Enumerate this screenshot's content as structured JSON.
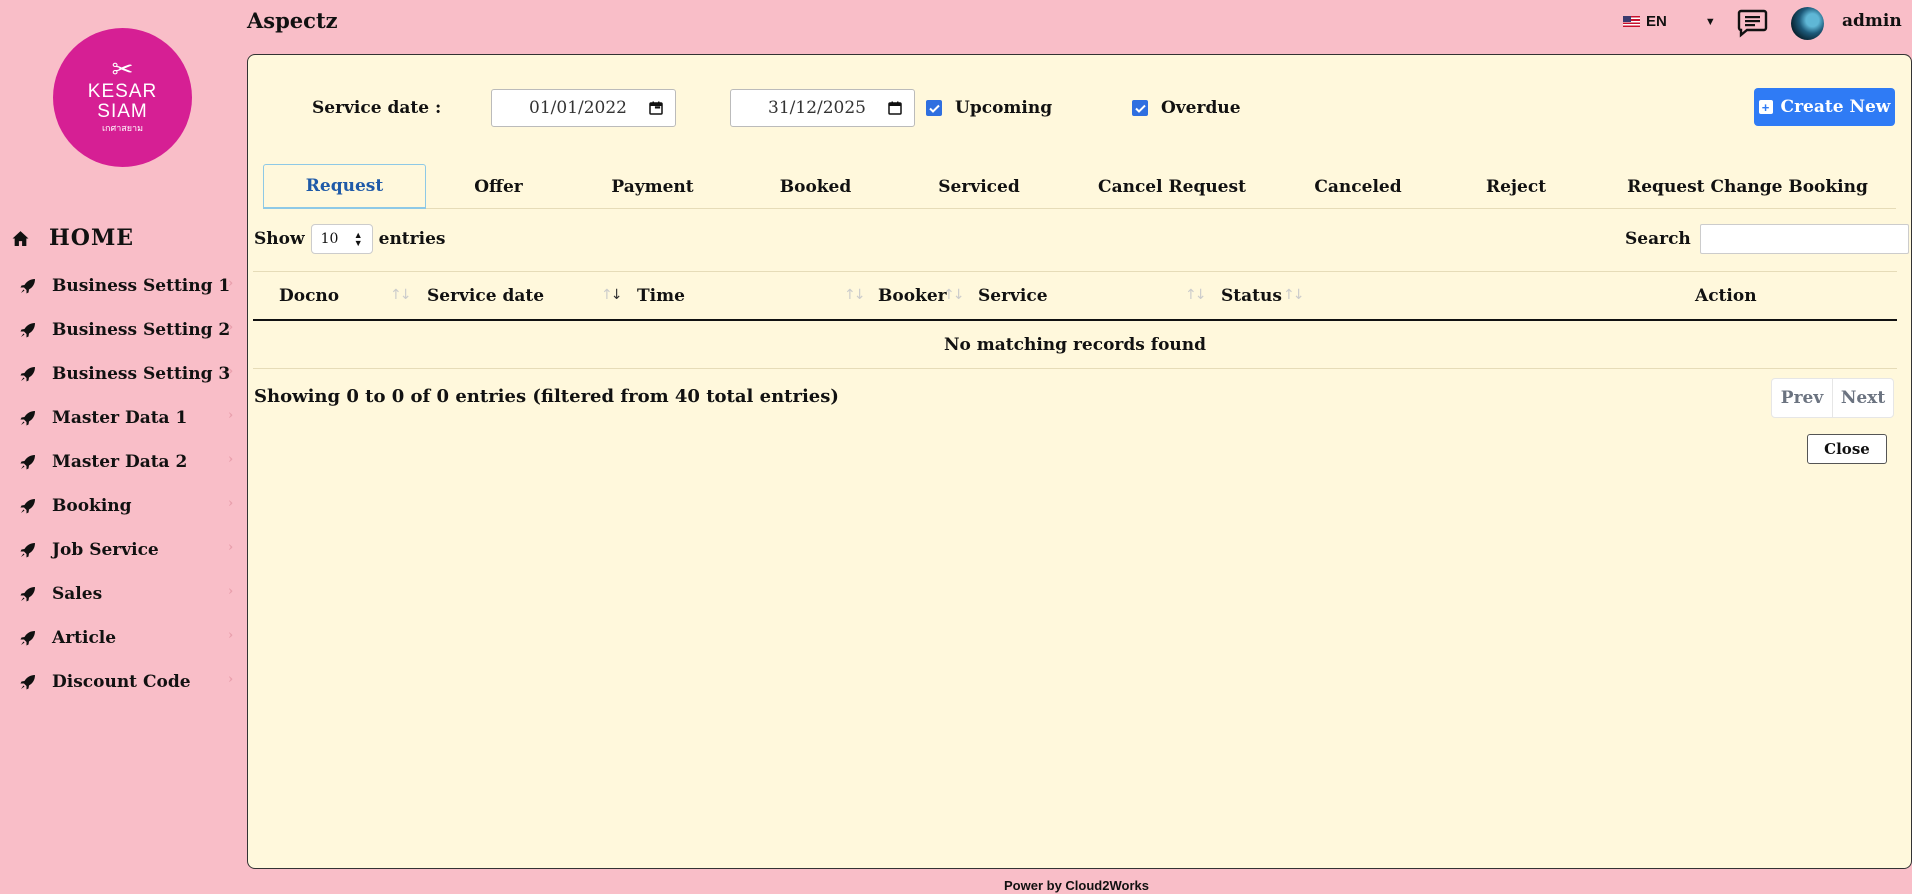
{
  "app": {
    "brand": "Aspectz",
    "logo": {
      "line1": "KESAR",
      "line2": "SIAM",
      "line3": "เกศาสยาม",
      "color": "#d61f94"
    },
    "language": "EN",
    "user": "admin"
  },
  "sidebar": {
    "home_label": "HOME",
    "items": [
      {
        "label": "Business Setting 1"
      },
      {
        "label": "Business Setting 2"
      },
      {
        "label": "Business Setting 3"
      },
      {
        "label": "Master Data 1"
      },
      {
        "label": "Master Data 2"
      },
      {
        "label": "Booking"
      },
      {
        "label": "Job Service"
      },
      {
        "label": "Sales"
      },
      {
        "label": "Article"
      },
      {
        "label": "Discount Code"
      }
    ]
  },
  "filters": {
    "service_date_label": "Service date :",
    "date_from": "01/01/2022",
    "separator": "-",
    "date_to": "31/12/2025",
    "upcoming_label": "Upcoming",
    "upcoming_checked": true,
    "overdue_label": "Overdue",
    "overdue_checked": true
  },
  "actions": {
    "create_new": "Create New",
    "close": "Close"
  },
  "tabs": [
    {
      "label": "Request",
      "active": true
    },
    {
      "label": "Offer"
    },
    {
      "label": "Payment"
    },
    {
      "label": "Booked"
    },
    {
      "label": "Serviced"
    },
    {
      "label": "Cancel Request"
    },
    {
      "label": "Canceled"
    },
    {
      "label": "Reject"
    },
    {
      "label": "Request Change Booking"
    }
  ],
  "table": {
    "show_label": "Show",
    "page_size": "10",
    "entries_label": "entries",
    "search_label": "Search",
    "columns": [
      "Docno",
      "Service date",
      "Time",
      "Booker",
      "Service",
      "Status",
      "Action"
    ],
    "empty_message": "No matching records found",
    "info": "Showing 0 to 0 of 0 entries (filtered from 40 total entries)",
    "prev_label": "Prev",
    "next_label": "Next"
  },
  "footer": {
    "text": "Power by Cloud2Works"
  },
  "colors": {
    "background": "#f9bec8",
    "panel": "#fff8dc",
    "primary": "#2f7bf5",
    "active_tab": "#1f5aa8"
  }
}
